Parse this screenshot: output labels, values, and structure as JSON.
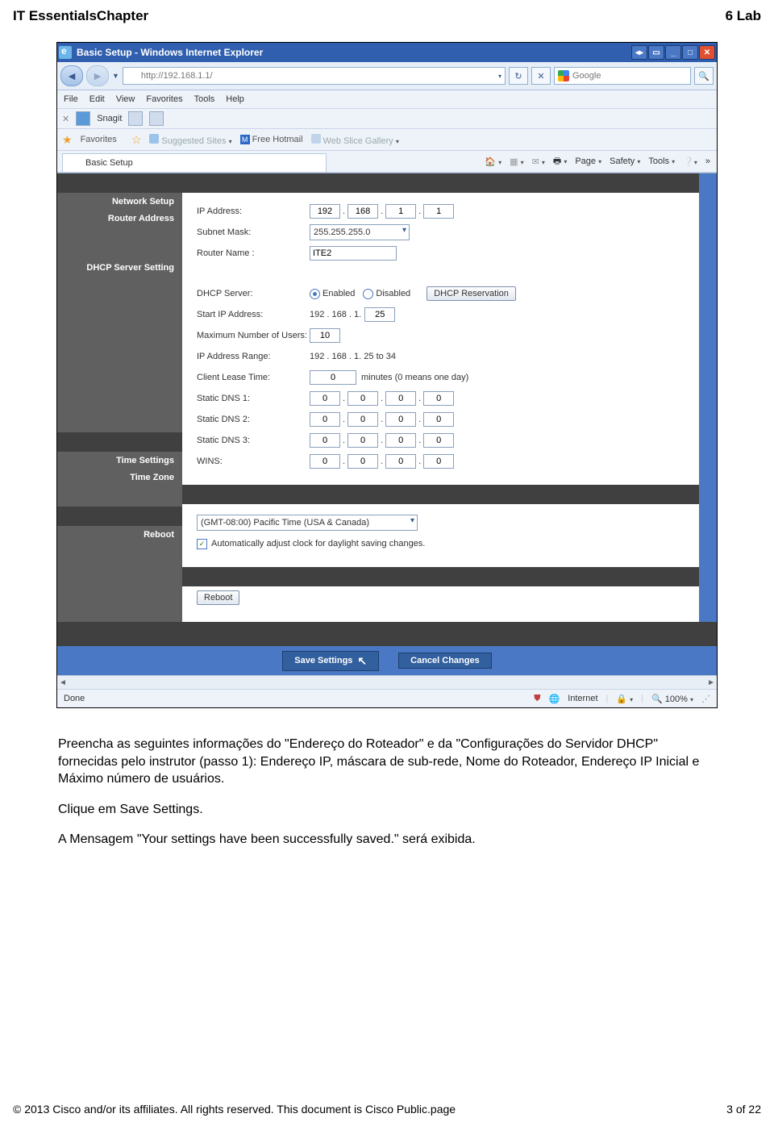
{
  "doc_header_left": "IT EssentialsChapter",
  "doc_header_right": "6 Lab",
  "window": {
    "title": "Basic Setup - Windows Internet Explorer",
    "url": "http://192.168.1.1/",
    "search_placeholder": "Google",
    "menu": [
      "File",
      "Edit",
      "View",
      "Favorites",
      "Tools",
      "Help"
    ],
    "snagit": "Snagit",
    "fav": "Favorites",
    "suggested": "Suggested Sites",
    "hotmail": "Free Hotmail",
    "webslice": "Web Slice Gallery",
    "tab": "Basic Setup",
    "tools": {
      "page": "Page",
      "safety": "Safety",
      "tools": "Tools"
    },
    "status_done": "Done",
    "status_internet": "Internet",
    "status_zoom": "100%"
  },
  "router": {
    "net_setup": "Network Setup",
    "router_addr": "Router Address",
    "ip_label": "IP Address:",
    "ip": [
      "192",
      "168",
      "1",
      "1"
    ],
    "subnet_label": "Subnet Mask:",
    "subnet": "255.255.255.0",
    "rname_label": "Router Name :",
    "rname": "ITE2",
    "dhcp_h": "DHCP Server Setting",
    "dhcp_label": "DHCP Server:",
    "enabled": "Enabled",
    "disabled": "Disabled",
    "dhcp_res": "DHCP Reservation",
    "start_label": "Start IP Address:",
    "start_prefix": "192 . 168 . 1.",
    "start_val": "25",
    "max_label": "Maximum Number of Users:",
    "max_val": "10",
    "range_label": "IP Address Range:",
    "range_val": "192 . 168 . 1. 25 to 34",
    "lease_label": "Client Lease Time:",
    "lease_val": "0",
    "lease_suffix": "minutes (0 means one day)",
    "dns1": "Static DNS 1:",
    "dns2": "Static DNS 2:",
    "dns3": "Static DNS 3:",
    "wins": "WINS:",
    "zero": "0",
    "time_h": "Time Settings",
    "tz_h": "Time Zone",
    "tz_val": "(GMT-08:00) Pacific Time (USA & Canada)",
    "dst": "Automatically adjust clock for daylight saving changes.",
    "reboot_h": "Reboot",
    "reboot_btn": "Reboot",
    "save": "Save Settings",
    "cancel": "Cancel Changes"
  },
  "body": {
    "p1": "Preencha as seguintes informações do \"Endereço do Roteador\" e da \"Configurações do Servidor DHCP\" fornecidas pelo instrutor (passo 1): Endereço IP, máscara de sub-rede, Nome do Roteador, Endereço IP Inicial e Máximo número de usuários.",
    "p2": "Clique em Save Settings.",
    "p3": "A Mensagem \"Your settings have been successfully saved.\" será exibida."
  },
  "footer_left": "© 2013 Cisco and/or its affiliates. All rights reserved. This document is Cisco Public.page",
  "footer_right": "3 of 22"
}
